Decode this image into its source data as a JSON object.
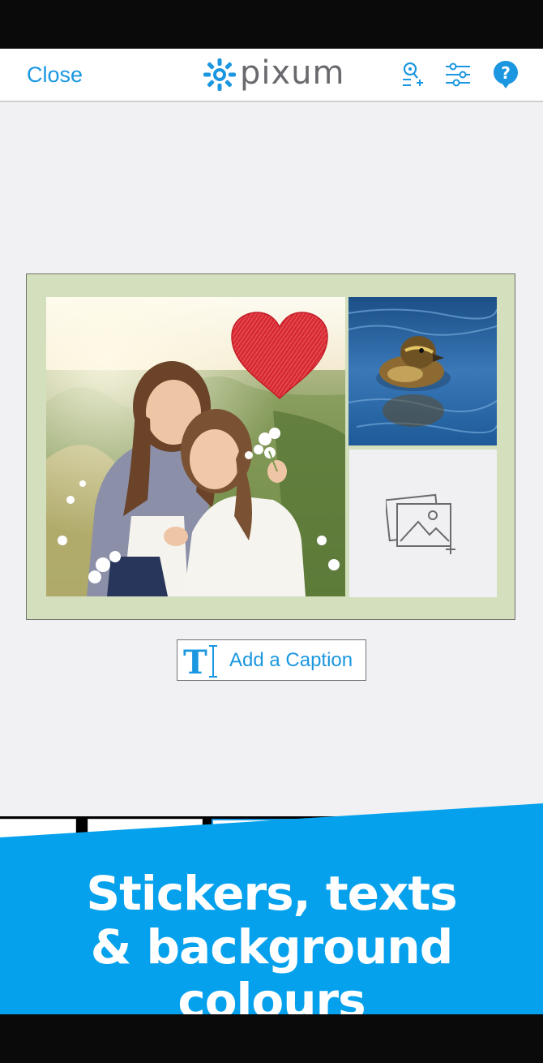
{
  "header": {
    "close_label": "Close",
    "logo_text": "pixum",
    "icons": [
      "zoom-add-icon",
      "sliders-icon",
      "help-icon"
    ]
  },
  "card": {
    "background_color": "#d3dfbd",
    "photos": [
      "girls-photo",
      "duckling-photo"
    ],
    "empty_slot_icon": "add-photo-icon",
    "sticker": "heart-sticker"
  },
  "caption": {
    "label": "Add a Caption",
    "icon": "text-cursor-icon"
  },
  "banner": {
    "line1": "Stickers, texts",
    "line2": "& background colours"
  },
  "colors": {
    "accent": "#1a97e0",
    "banner": "#05a1ec"
  }
}
